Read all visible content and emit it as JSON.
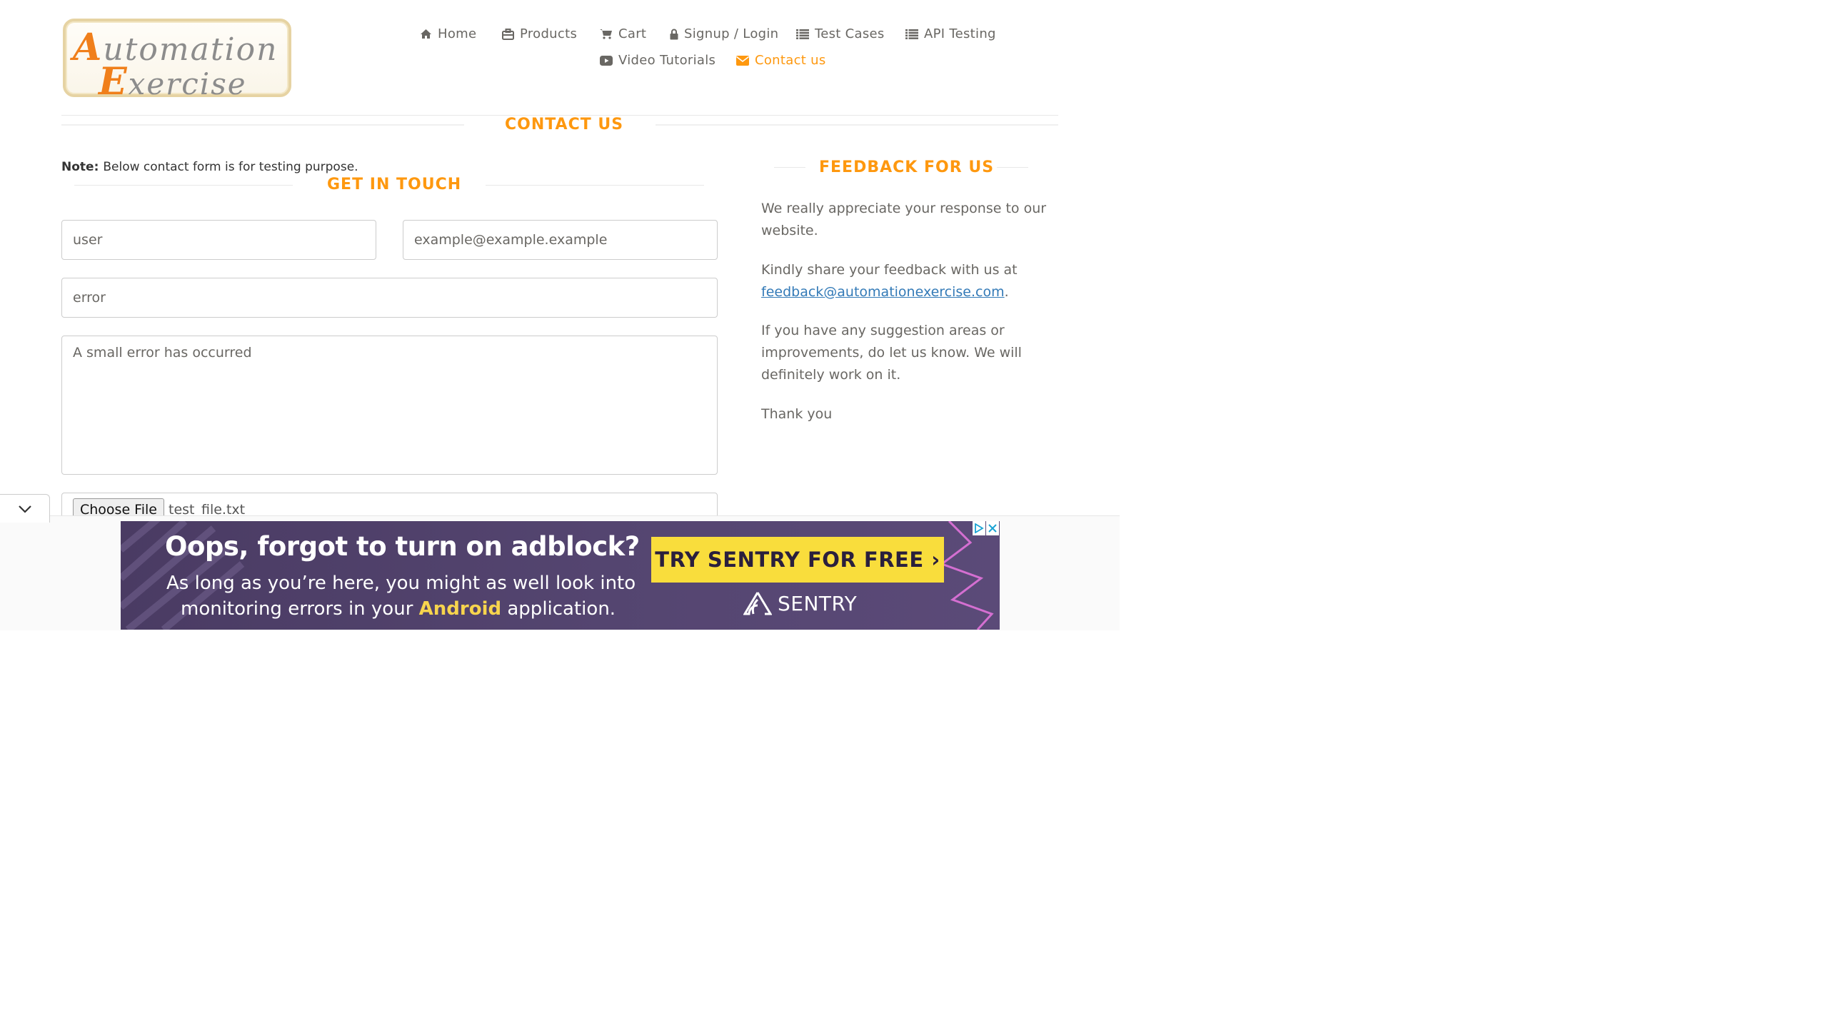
{
  "colors": {
    "accent": "#FE980F",
    "text": "#696763",
    "link": "#337ab7",
    "ad_bg": "#4a3b63",
    "ad_cta": "#f9dd3c"
  },
  "logo": {
    "line1_cap": "A",
    "line1_rest": "utomation",
    "line2_cap": "E",
    "line2_rest": "xercise"
  },
  "nav": {
    "home": {
      "label": "Home",
      "icon": "home-icon"
    },
    "products": {
      "label": "Products",
      "icon": "briefcase-icon"
    },
    "cart": {
      "label": "Cart",
      "icon": "cart-icon"
    },
    "login": {
      "label": "Signup / Login",
      "icon": "lock-icon"
    },
    "test_cases": {
      "label": "Test Cases",
      "icon": "list-icon"
    },
    "api_testing": {
      "label": "API Testing",
      "icon": "list-icon"
    },
    "video": {
      "label": "Video Tutorials",
      "icon": "youtube-play-icon"
    },
    "contact": {
      "label": "Contact us",
      "icon": "envelope-icon"
    }
  },
  "page_title": "CONTACT US",
  "note": {
    "bold": "Note:",
    "text": "Below contact form is for testing purpose."
  },
  "form": {
    "title": "GET IN TOUCH",
    "name_value": "user",
    "email_value": "example@example.example",
    "subject_value": "error",
    "message_value": "A small error has occurred",
    "file_button": "Choose File",
    "file_name": "test_file.txt"
  },
  "feedback": {
    "title": "FEEDBACK FOR US",
    "p1": "We really appreciate your response to our website.",
    "p2_prefix": "Kindly share your feedback with us at",
    "email": "feedback@automationexercise.com",
    "p2_suffix": ".",
    "p3": "If you have any suggestion areas or improvements, do let us know. We will definitely work on it.",
    "p4": "Thank you"
  },
  "ad": {
    "headline": "Oops, forgot to turn on adblock?",
    "line1": "As long as you’re here, you might as well look into",
    "line2_prefix": "monitoring errors in your",
    "line2_highlight": "Android",
    "line2_suffix": "application.",
    "cta": "TRY SENTRY FOR FREE ›",
    "brand": "SENTRY"
  }
}
